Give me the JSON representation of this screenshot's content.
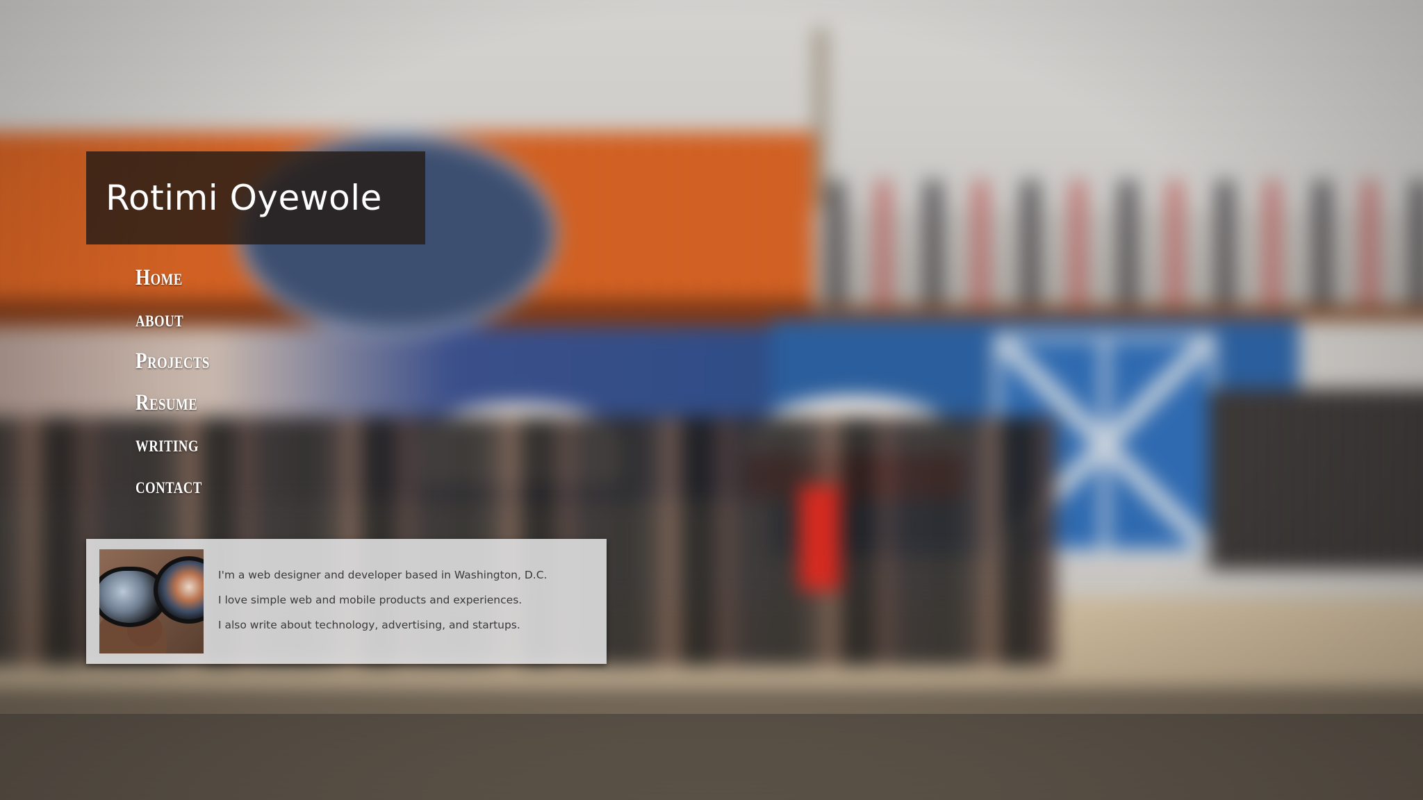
{
  "site": {
    "title": "Rotimi Oyewole"
  },
  "nav": {
    "items": [
      {
        "label": "Home"
      },
      {
        "label": "about"
      },
      {
        "label": "Projects"
      },
      {
        "label": "Resume"
      },
      {
        "label": "writing"
      },
      {
        "label": "contact"
      }
    ]
  },
  "about": {
    "avatar_icon": "profile-photo",
    "lines": [
      "I'm a web designer and developer based in Washington, D.C.",
      "I love simple web and mobile products and experiences.",
      "I also write about technology, advertising, and startups."
    ]
  },
  "colors": {
    "title_bg": "#261c16",
    "card_bg": "#e2e2e4",
    "text": "#3a3a3a",
    "nav_text": "#ffffff"
  }
}
